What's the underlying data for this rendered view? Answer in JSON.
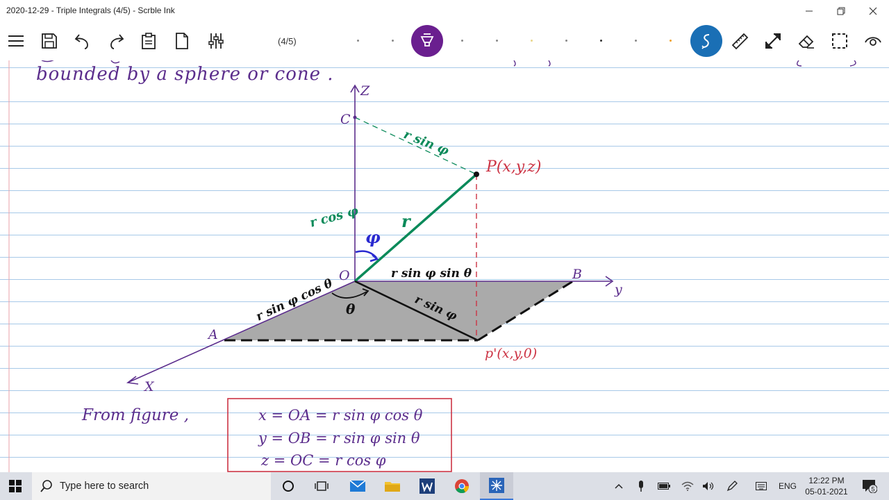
{
  "window": {
    "title": "2020-12-29 - Triple Integrals  (4/5) - Scrble Ink"
  },
  "toolbar": {
    "page_indicator": "(4/5)",
    "icons": [
      "menu-icon",
      "save-icon",
      "undo-icon",
      "redo-icon",
      "clipboard-icon",
      "page-icon",
      "sliders-icon",
      "pen-icon",
      "lasso-icon",
      "ruler-icon",
      "expand-icon",
      "eraser-icon",
      "select-icon",
      "view-icon"
    ],
    "accent_purple": "#6a1f8f",
    "accent_blue": "#1a6fb5"
  },
  "note": {
    "top_line": "bounded   by   a   sphere  or  cone .",
    "axis_z": "Z",
    "axis_y": "y",
    "axis_x": "X",
    "point_c": "C",
    "point_o": "O",
    "point_a": "A",
    "point_b": "B",
    "point_p": "P(x,y,z)",
    "point_p_prime": "p'(x,y,0)",
    "label_r_sin_phi_top": "r sin φ",
    "label_r_cos_phi": "r cos φ",
    "label_r": "r",
    "label_phi": "φ",
    "label_theta": "θ",
    "label_r_sin_phi_sin_theta": "r sin φ sin θ",
    "label_r_sin_phi_cos_theta": "r sin φ cos θ",
    "label_r_sin_phi_base": "r sin φ",
    "from_figure": "From   figure ,",
    "eq1": "x = OA = r sin φ cos θ",
    "eq2": "y = OB = r sin φ sin θ",
    "eq3": "z = OC = r cos φ",
    "colors": {
      "ink_purple": "#5b2d8c",
      "ink_green": "#0b8a5a",
      "ink_red": "#cc3344",
      "ink_black": "#111111",
      "fill_gray": "#aaaaaa"
    }
  },
  "taskbar": {
    "search_placeholder": "Type here to search",
    "language": "ENG",
    "time": "12:22 PM",
    "date": "05-01-2021",
    "notification_count": "5"
  }
}
